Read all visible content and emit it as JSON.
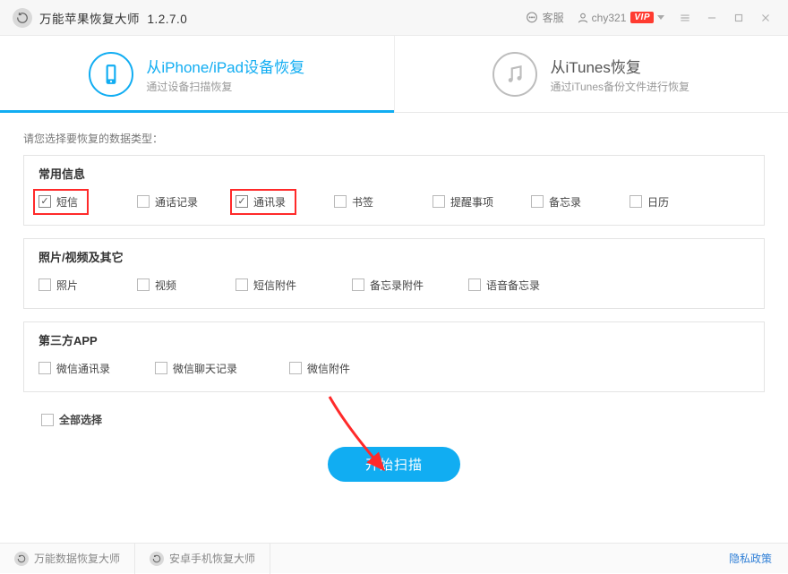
{
  "titlebar": {
    "app_name": "万能苹果恢复大师",
    "version": "1.2.7.0",
    "service_label": "客服",
    "username": "chy321",
    "vip_badge": "VIP"
  },
  "tabs": {
    "device": {
      "title": "从iPhone/iPad设备恢复",
      "subtitle": "通过设备扫描恢复"
    },
    "itunes": {
      "title": "从iTunes恢复",
      "subtitle": "通过iTunes备份文件进行恢复"
    }
  },
  "content": {
    "prompt": "请您选择要恢复的数据类型：",
    "group1": {
      "header": "常用信息",
      "items": [
        "短信",
        "通话记录",
        "通讯录",
        "书签",
        "提醒事项",
        "备忘录",
        "日历"
      ]
    },
    "group2": {
      "header": "照片/视频及其它",
      "items": [
        "照片",
        "视频",
        "短信附件",
        "备忘录附件",
        "语音备忘录"
      ]
    },
    "group3": {
      "header": "第三方APP",
      "items": [
        "微信通讯录",
        "微信聊天记录",
        "微信附件"
      ]
    },
    "select_all": "全部选择",
    "scan_button": "开始扫描"
  },
  "bottombar": {
    "tab1": "万能数据恢复大师",
    "tab2": "安卓手机恢复大师",
    "privacy": "隐私政策"
  }
}
